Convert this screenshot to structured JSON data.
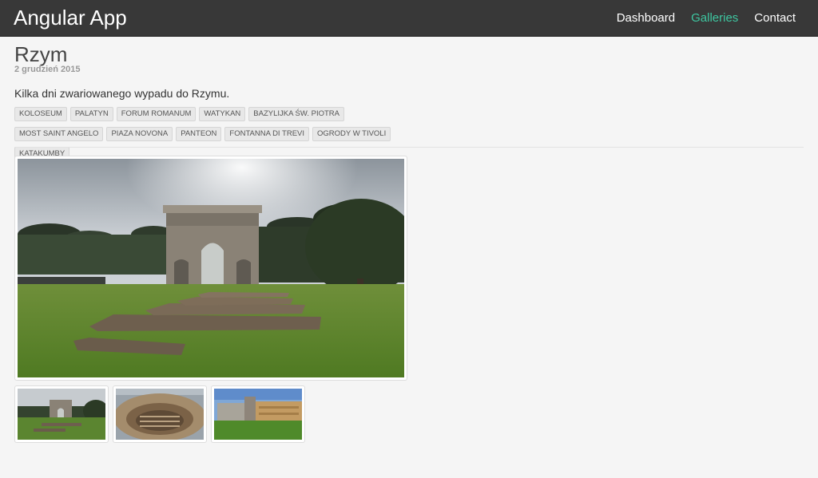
{
  "navbar": {
    "brand": "Angular App",
    "links": [
      {
        "label": "Dashboard",
        "active": false
      },
      {
        "label": "Galleries",
        "active": true
      },
      {
        "label": "Contact",
        "active": false
      }
    ],
    "active_color": "#3ec7a1"
  },
  "gallery": {
    "title": "Rzym",
    "date": "2 grudzień 2015",
    "description": "Kilka dni zwariowanego wypadu do Rzymu.",
    "tags": [
      "KOLOSEUM",
      "PALATYN",
      "FORUM ROMANUM",
      "WATYKAN",
      "BAZYLIJKA ŚW. PIOTRA",
      "MOST SAINT ANGELO",
      "PIAZA NOVONA",
      "PANTEON",
      "FONTANNA DI TREVI",
      "OGRODY W TIVOLI",
      "KATAKUMBY"
    ]
  },
  "images": {
    "main": "arch-of-constantine-photo",
    "thumbnails": [
      "arch-of-constantine-thumb",
      "colosseum-interior-thumb",
      "vatican-buildings-thumb"
    ]
  }
}
